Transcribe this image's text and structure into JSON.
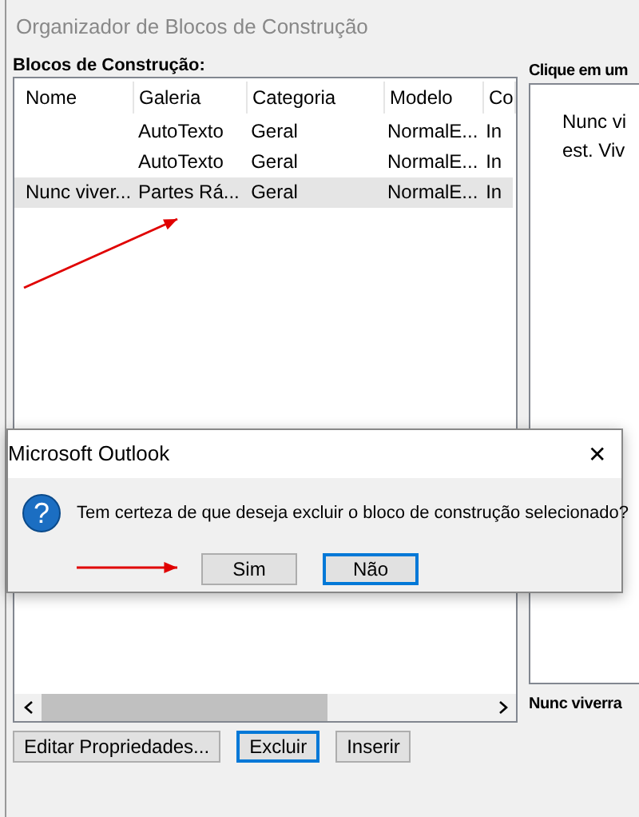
{
  "window": {
    "title": "Organizador de Blocos de Construção"
  },
  "blocks_label": "Blocos de Construção:",
  "table": {
    "columns": [
      "Nome",
      "Galeria",
      "Categoria",
      "Modelo",
      "Co"
    ],
    "rows": [
      {
        "cells": [
          "",
          "AutoTexto",
          "Geral",
          "NormalE...",
          "In"
        ],
        "selected": false
      },
      {
        "cells": [
          "",
          "AutoTexto",
          "Geral",
          "NormalE...",
          "In"
        ],
        "selected": false
      },
      {
        "cells": [
          "Nunc viver...",
          "Partes Rá...",
          "Geral",
          "NormalE...",
          "In"
        ],
        "selected": true
      }
    ]
  },
  "buttons": [
    {
      "label": "Editar Propriedades...",
      "focused": false
    },
    {
      "label": "Excluir",
      "focused": true
    },
    {
      "label": "Inserir",
      "focused": false
    }
  ],
  "preview": {
    "label": "Clique em um",
    "lines": [
      "Nunc vi",
      "est. Viv"
    ],
    "caption": "Nunc viverra"
  },
  "dialog": {
    "title": "Microsoft Outlook",
    "close": "✕",
    "icon": "?",
    "message": "Tem certeza de que deseja excluir o bloco de construção selecionado?",
    "buttons": [
      {
        "label": "Sim",
        "focused": false
      },
      {
        "label": "Não",
        "focused": true
      }
    ]
  }
}
